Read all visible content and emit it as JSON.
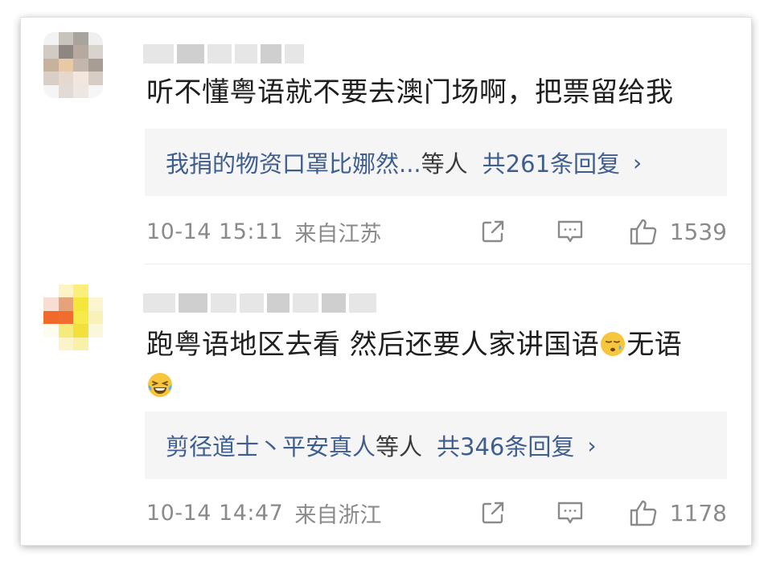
{
  "comments": [
    {
      "text": "听不懂粤语就不要去澳门场啊，把票留给我",
      "text_suffix": "",
      "emoji1": "",
      "emoji2": "",
      "replies": {
        "names": "我捐的物资口罩比娜然...",
        "suffix": "等人",
        "count": "共261条回复",
        "chevron": "›"
      },
      "meta": {
        "time": "10-14 15:11",
        "location": "来自江苏",
        "likes": "1539"
      },
      "avatar_icon": "pixelated-avatar"
    },
    {
      "text": "跑粤语地区去看 然后还要人家讲国语",
      "text_suffix": "无语",
      "emoji1": "cold-sweat-emoji",
      "emoji2": "laughing-tears-emoji",
      "replies": {
        "names": "剪径道士丶平安真人",
        "suffix": "等人",
        "count": "共346条回复",
        "chevron": "›"
      },
      "meta": {
        "time": "10-14 14:47",
        "location": "来自浙江",
        "likes": "1178"
      },
      "avatar_icon": "pixelated-avatar"
    }
  ],
  "icons": {
    "share": "share-icon",
    "comment": "comment-icon",
    "like": "thumbs-up-icon"
  },
  "colors": {
    "reply_link": "#3e5e8f",
    "meta": "#8a8a8a",
    "text": "#1e1e1e",
    "reply_bg": "#f5f5f5"
  }
}
